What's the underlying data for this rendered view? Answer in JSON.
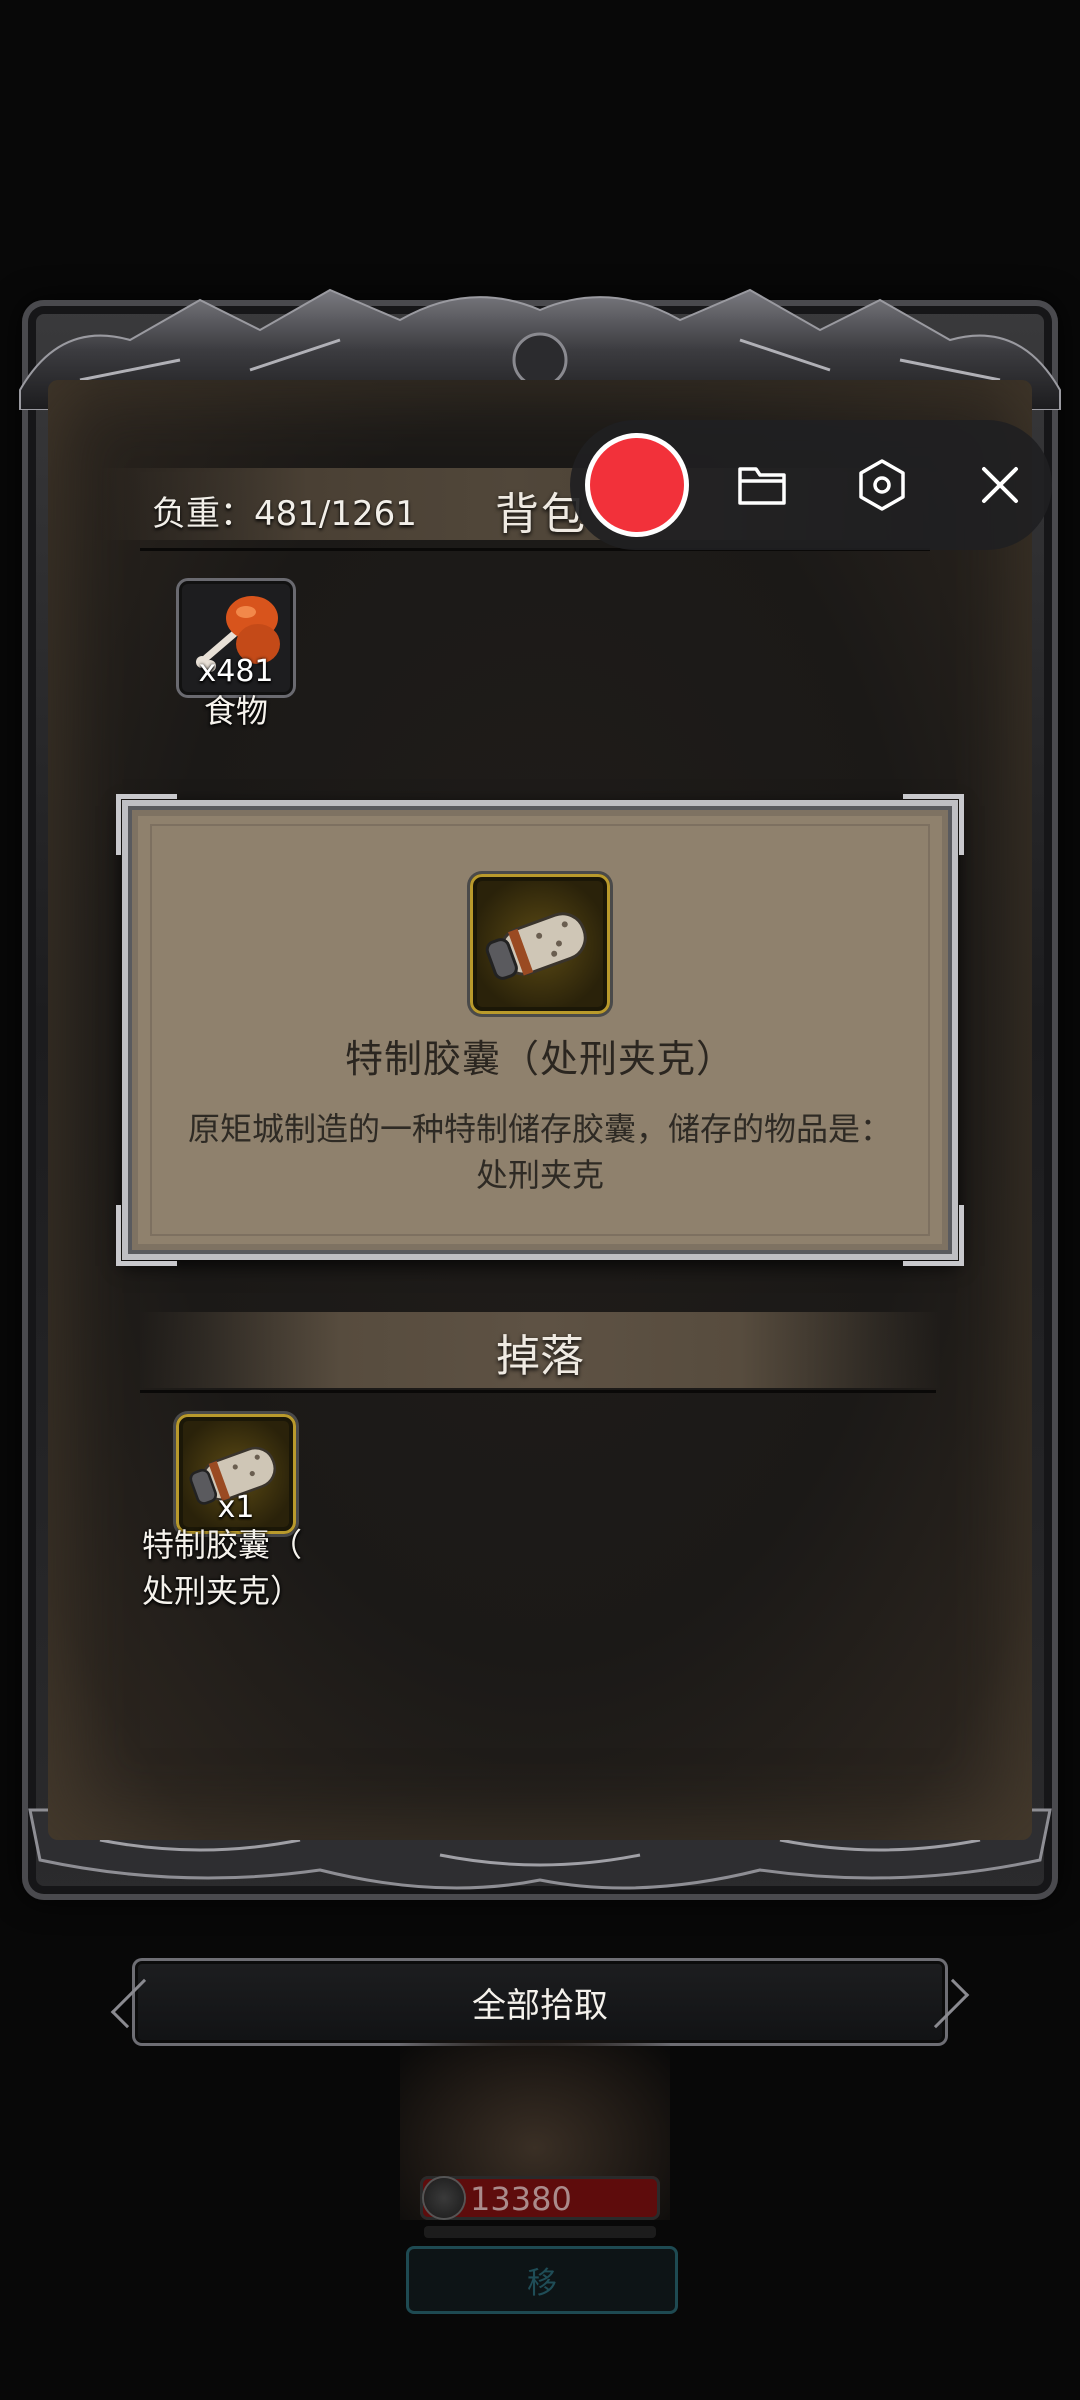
{
  "backpack": {
    "weight_label": "负重：481/1261",
    "title": "背包",
    "items": [
      {
        "name": "食物",
        "quantity": "x481",
        "icon": "food-meat-icon"
      }
    ]
  },
  "detail_panel": {
    "item_icon": "capsule-icon",
    "title": "特制胶囊（处刑夹克）",
    "description": "原矩城制造的一种特制储存胶囊，储存的物品是：处刑夹克"
  },
  "drop": {
    "title": "掉落",
    "items": [
      {
        "name_line1": "特制胶囊（",
        "name_line2": "处刑夹克）",
        "quantity": "x1",
        "icon": "capsule-icon"
      }
    ]
  },
  "actions": {
    "pick_all_label": "全部拾取"
  },
  "hud": {
    "hp_value": "13380",
    "move_label": "移"
  },
  "recorder_toolbar": {
    "record_icon": "record-icon",
    "folder_icon": "folder-icon",
    "settings_icon": "settings-hexagon-icon",
    "close_icon": "close-icon"
  }
}
